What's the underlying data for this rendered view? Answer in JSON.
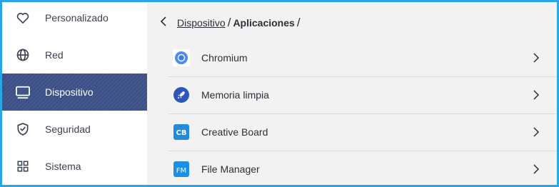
{
  "sidebar": {
    "items": [
      {
        "label": "Personalizado",
        "icon": "heart-icon"
      },
      {
        "label": "Red",
        "icon": "globe-icon"
      },
      {
        "label": "Dispositivo",
        "icon": "monitor-icon",
        "active": true
      },
      {
        "label": "Seguridad",
        "icon": "shield-check-icon"
      },
      {
        "label": "Sistema",
        "icon": "grid-icon"
      }
    ],
    "active_color": "#3b4f86"
  },
  "breadcrumb": {
    "back_icon": "chevron-left-icon",
    "parent": "Dispositivo",
    "separator": "/",
    "current": "Aplicaciones",
    "trailing_separator": "/"
  },
  "apps": [
    {
      "label": "Chromium",
      "icon": "chromium-icon"
    },
    {
      "label": "Memoria limpia",
      "icon": "rocket-icon"
    },
    {
      "label": "Creative Board",
      "icon": "creative-board-icon",
      "icon_text": "CB"
    },
    {
      "label": "File Manager",
      "icon": "file-manager-icon",
      "icon_text": "FM"
    }
  ],
  "colors": {
    "frame": "#2aa6e6",
    "background": "#f2f2f2"
  }
}
